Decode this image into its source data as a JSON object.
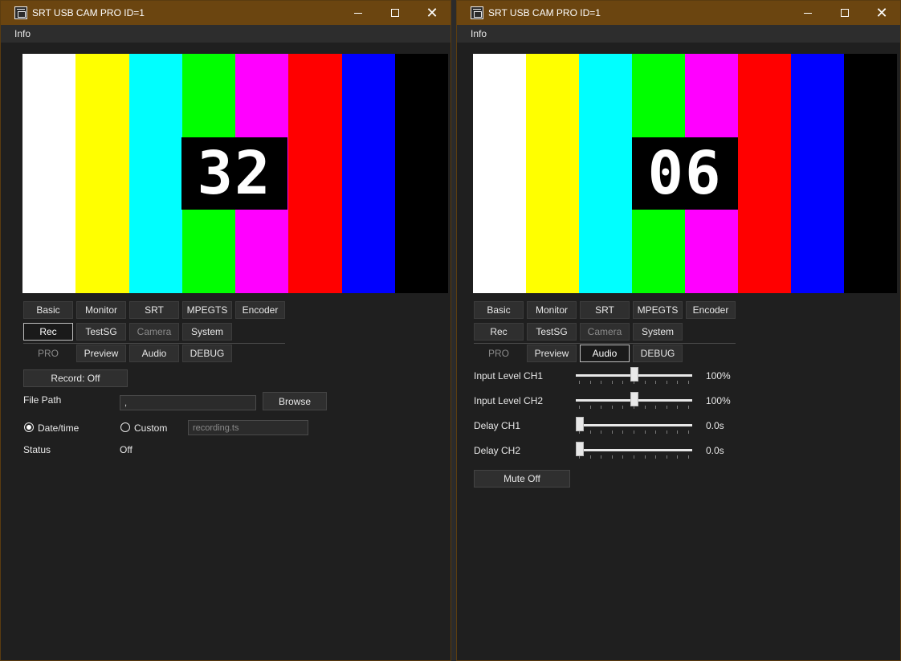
{
  "colors": {
    "titlebar": "#6b4510",
    "bars": [
      "#ffffff",
      "#ffff00",
      "#00ffff",
      "#00ff00",
      "#ff00ff",
      "#ff0000",
      "#0000ff",
      "#000000"
    ]
  },
  "windows": [
    {
      "title": "SRT USB CAM PRO ID=1",
      "menu": "Info",
      "counter": "32",
      "tabs_row1": [
        "Basic",
        "Monitor",
        "SRT",
        "MPEGTS",
        "Encoder"
      ],
      "tabs_row2": [
        "Rec",
        "TestSG",
        "Camera",
        "System"
      ],
      "tabs_row3": [
        "PRO",
        "Preview",
        "Audio",
        "DEBUG"
      ],
      "active_tab": "Rec",
      "rec": {
        "record_button": "Record: Off",
        "file_path_label": "File Path",
        "file_path_value": ",",
        "browse_button": "Browse",
        "radio_datetime": "Date/time",
        "radio_custom": "Custom",
        "custom_placeholder": "recording.ts",
        "selected_radio": "Date/time",
        "status_label": "Status",
        "status_value": "Off"
      }
    },
    {
      "title": "SRT USB CAM PRO ID=1",
      "menu": "Info",
      "counter": "06",
      "tabs_row1": [
        "Basic",
        "Monitor",
        "SRT",
        "MPEGTS",
        "Encoder"
      ],
      "tabs_row2": [
        "Rec",
        "TestSG",
        "Camera",
        "System"
      ],
      "tabs_row3": [
        "PRO",
        "Preview",
        "Audio",
        "DEBUG"
      ],
      "active_tab": "Audio",
      "audio": {
        "controls": [
          {
            "label": "Input Level CH1",
            "value": "100%",
            "level": 0.5
          },
          {
            "label": "Input Level CH2",
            "value": "100%",
            "level": 0.5
          },
          {
            "label": "Delay CH1",
            "value": "0.0s",
            "level": 0.0
          },
          {
            "label": "Delay CH2",
            "value": "0.0s",
            "level": 0.0
          }
        ],
        "mute_button": "Mute Off"
      }
    }
  ]
}
